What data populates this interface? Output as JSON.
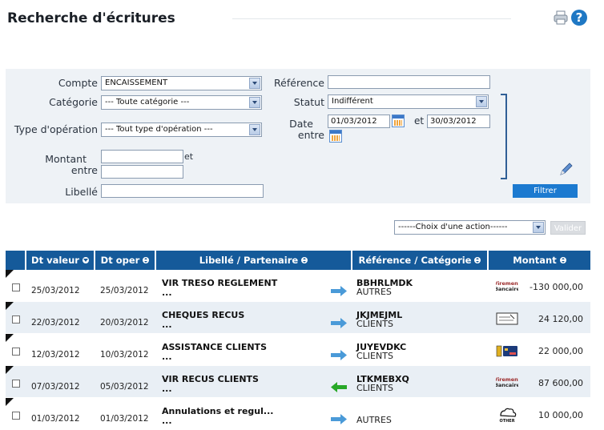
{
  "page": {
    "title": "Recherche d'écritures"
  },
  "filters": {
    "compte_label": "Compte",
    "compte_value": "ENCAISSEMENT",
    "categorie_label": "Catégorie",
    "categorie_value": "--- Toute catégorie ---",
    "type_label": "Type d'opération",
    "type_value": "--- Tout type d'opération ---",
    "montant_label_1": "Montant",
    "montant_label_2": "entre",
    "montant_et": "et",
    "montant_min": "",
    "montant_max": "",
    "libelle_label": "Libellé",
    "libelle_value": "",
    "reference_label": "Référence",
    "reference_value": "",
    "statut_label": "Statut",
    "statut_value": "Indifférent",
    "date_label_1": "Date",
    "date_label_2": "entre",
    "date_from": "01/03/2012",
    "date_et": "et",
    "date_to": "30/03/2012",
    "filter_button": "Filtrer"
  },
  "actions": {
    "select_value": "------Choix d'une action------",
    "valider_button": "Valider"
  },
  "table": {
    "headers": {
      "dt_valeur": "Dt valeur",
      "dt_oper": "Dt oper",
      "libelle": "Libellé / Partenaire",
      "reference": "Référence / Catégorie",
      "montant": "Montant"
    },
    "rows": [
      {
        "dt_valeur": "25/03/2012",
        "dt_oper": "25/03/2012",
        "libelle": "VIR TRESO REGLEMENT",
        "sub": "...",
        "direction": "out",
        "reference": "BBHRLMDK",
        "categorie": "AUTRES",
        "pay_type": "virement-icon",
        "montant": "-130 000,00"
      },
      {
        "dt_valeur": "22/03/2012",
        "dt_oper": "20/03/2012",
        "libelle": "CHEQUES RECUS",
        "sub": "...",
        "direction": "out",
        "reference": "JKJMEJML",
        "categorie": "CLIENTS",
        "pay_type": "cheque-icon",
        "montant": "24 120,00"
      },
      {
        "dt_valeur": "12/03/2012",
        "dt_oper": "10/03/2012",
        "libelle": "ASSISTANCE CLIENTS",
        "sub": "...",
        "direction": "out",
        "reference": "JUYEVDKC",
        "categorie": "CLIENTS",
        "pay_type": "card-icon",
        "montant": "22 000,00"
      },
      {
        "dt_valeur": "07/03/2012",
        "dt_oper": "05/03/2012",
        "libelle": "VIR RECUS CLIENTS",
        "sub": "...",
        "direction": "in",
        "reference": "LTKMEBXQ",
        "categorie": "CLIENTS",
        "pay_type": "virement-icon",
        "montant": "87 600,00"
      },
      {
        "dt_valeur": "01/03/2012",
        "dt_oper": "01/03/2012",
        "libelle": "Annulations et regul...",
        "sub": "...",
        "direction": "out",
        "reference": "",
        "categorie": "AUTRES",
        "pay_type": "other-icon",
        "montant": "10 000,00"
      }
    ]
  },
  "icon_labels": {
    "virement_1": "Virement",
    "virement_2": "Bancaire",
    "other": "OTHER"
  },
  "colors": {
    "header_blue": "#155a9a",
    "filter_bg": "#eef2f6",
    "button_blue": "#1c7ad0",
    "arrow_blue": "#4a9ad8",
    "arrow_green": "#28a828"
  }
}
